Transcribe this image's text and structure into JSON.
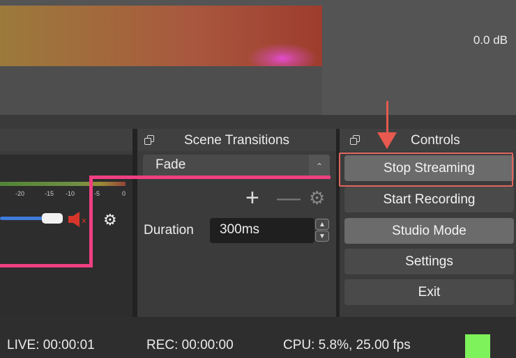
{
  "preview": {},
  "mixer": {
    "db_value": "0.0 dB",
    "ticks": [
      "-20",
      "-15",
      "-10",
      "-5",
      "0"
    ]
  },
  "transitions": {
    "title": "Scene Transitions",
    "selected": "Fade",
    "add": "+",
    "remove": "—",
    "duration_label": "Duration",
    "duration_value": "300ms"
  },
  "controls": {
    "title": "Controls",
    "stop_streaming": "Stop Streaming",
    "start_recording": "Start Recording",
    "studio_mode": "Studio Mode",
    "settings": "Settings",
    "exit": "Exit"
  },
  "status": {
    "live": "LIVE: 00:00:01",
    "rec": "REC: 00:00:00",
    "cpu": "CPU: 5.8%, 25.00 fps",
    "indicator_color": "#7ef25a"
  },
  "annotations": {
    "highlight_color": "#e1665f",
    "arrow_color": "#e8594f",
    "line_color": "#f03f82"
  }
}
